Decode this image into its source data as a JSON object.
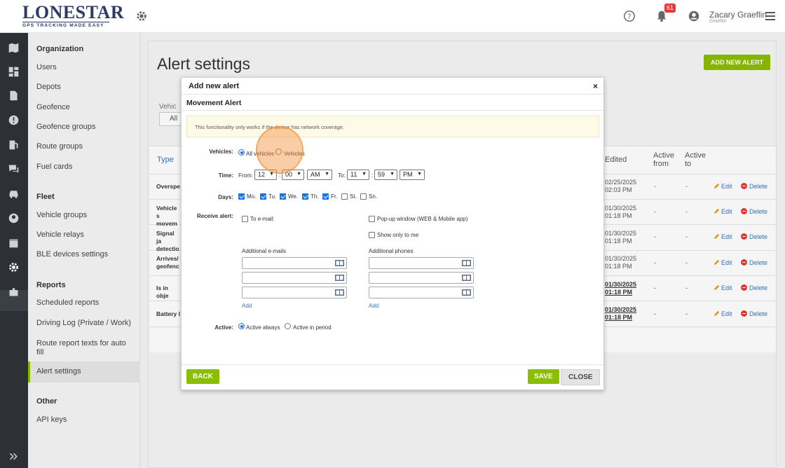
{
  "brand": {
    "name": "LONESTAR",
    "small": "TRACKING",
    "tagline": "GPS TRACKING MADE EASY"
  },
  "header": {
    "notifications_count": "61",
    "user_name": "Zacary Graeflin",
    "user_sub": "Graeflin"
  },
  "sidebar": {
    "organization_title": "Organization",
    "organization_items": [
      "Users",
      "Depots",
      "Geofence",
      "Geofence groups",
      "Route groups",
      "Fuel cards"
    ],
    "fleet_title": "Fleet",
    "fleet_items": [
      "Vehicle groups",
      "Vehicle relays",
      "BLE devices settings"
    ],
    "reports_title": "Reports",
    "reports_items": [
      "Scheduled reports",
      "Driving Log (Private / Work)",
      "Route report texts for auto fill",
      "Alert settings"
    ],
    "other_title": "Other",
    "other_items": [
      "API keys"
    ]
  },
  "page": {
    "title": "Alert settings",
    "add_button": "ADD NEW ALERT",
    "vehicle_filter_label": "Vehic",
    "vehicle_filter_value": "All"
  },
  "table": {
    "headers": {
      "type": "Type",
      "edited": "Edited",
      "active_from": "Active from",
      "active_to": "Active to"
    },
    "rows": [
      {
        "type": "Overspe",
        "date": "02/25/2025",
        "time": "02:03 PM",
        "from": "-",
        "to": "-"
      },
      {
        "type": "Vehicle s movem",
        "date": "01/30/2025",
        "time": "01:18 PM",
        "from": "-",
        "to": "-"
      },
      {
        "type": "Signal ja detectio",
        "date": "01/30/2025",
        "time": "01:18 PM",
        "from": "-",
        "to": "-"
      },
      {
        "type": "Arrives/ geofenc",
        "date": "01/30/2025",
        "time": "01:18 PM",
        "from": "-",
        "to": "-"
      },
      {
        "type": "Is in obje",
        "date": "01/30/2025",
        "time": "01:18 PM",
        "from": "-",
        "to": "-"
      },
      {
        "type": "Battery l",
        "date": "01/30/2025",
        "time": "01:18 PM",
        "from": "-",
        "to": "-"
      }
    ],
    "edit_label": "Edit",
    "delete_label": "Delete"
  },
  "modal": {
    "title": "Add new alert",
    "close": "×",
    "subtitle": "Movement Alert",
    "notice": "This functionality only works if the device has network coverage.",
    "vehicles_label": "Vehicles:",
    "vehicles_options": [
      "All vehicles",
      "Vehicles"
    ],
    "vehicles_selected": "All vehicles",
    "time_label": "Time:",
    "from_label": "From:",
    "from_hour": "12",
    "from_min": "00",
    "from_ampm": "AM",
    "to_label": "To:",
    "to_hour": "11",
    "to_min": "59",
    "to_ampm": "PM",
    "colon": ":",
    "days_label": "Days:",
    "days": [
      {
        "label": "Mo.",
        "checked": true
      },
      {
        "label": "Tu.",
        "checked": true
      },
      {
        "label": "We.",
        "checked": true
      },
      {
        "label": "Th.",
        "checked": true
      },
      {
        "label": "Fr.",
        "checked": true
      },
      {
        "label": "St.",
        "checked": false
      },
      {
        "label": "Sn.",
        "checked": false
      }
    ],
    "receive_label": "Receive alert:",
    "to_email": "To e-mail:",
    "popup": "Pop-up window (WEB & Mobile app)",
    "only_me": "Show only to me",
    "additional_emails": "Additional e-mails",
    "additional_phones": "Additional phones",
    "add_link": "Add",
    "active_label": "Active:",
    "active_options": [
      "Active always",
      "Active in period"
    ],
    "active_selected": "Active always",
    "back": "BACK",
    "save": "SAVE",
    "close_button": "CLOSE"
  },
  "colors": {
    "accent": "#8bbd00",
    "link": "#3575c0",
    "rail": "#2d3136"
  }
}
